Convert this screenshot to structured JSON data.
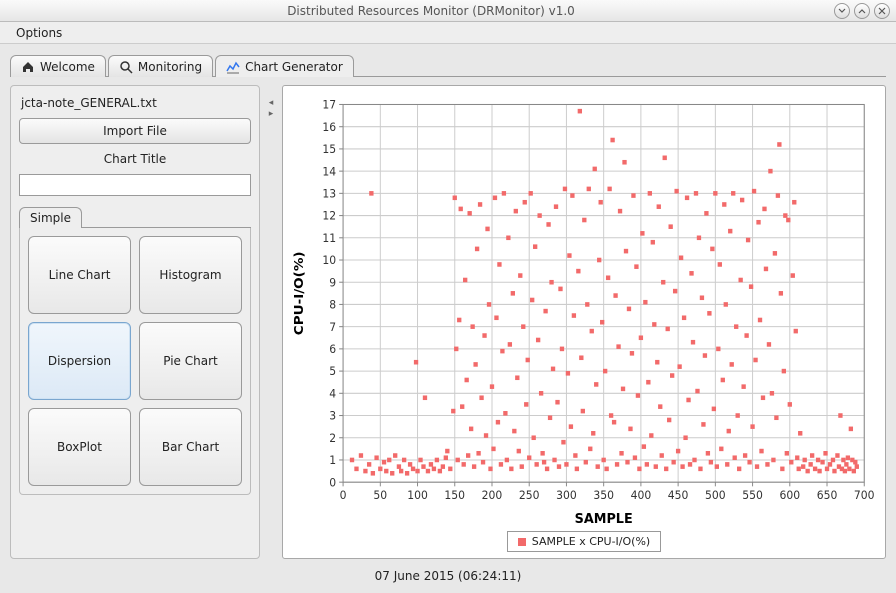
{
  "window": {
    "title": "Distributed Resources Monitor (DRMonitor) v1.0"
  },
  "menu": {
    "options": "Options"
  },
  "tabs": {
    "welcome": "Welcome",
    "monitoring": "Monitoring",
    "chart_gen": "Chart Generator"
  },
  "left": {
    "filename": "jcta-note_GENERAL.txt",
    "import_btn": "Import File",
    "chart_title_label": "Chart Title",
    "chart_title_value": "",
    "inner_tab": "Simple",
    "types": {
      "line": "Line Chart",
      "hist": "Histogram",
      "disp": "Dispersion",
      "pie": "Pie Chart",
      "box": "BoxPlot",
      "bar": "Bar Chart"
    }
  },
  "chart": {
    "xlabel": "SAMPLE",
    "ylabel": "CPU-I/O(%)",
    "legend": "SAMPLE x CPU-I/O(%)",
    "xrange": [
      0,
      700
    ],
    "yrange": [
      0,
      17
    ],
    "xticks": [
      0,
      50,
      100,
      150,
      200,
      250,
      300,
      350,
      400,
      450,
      500,
      550,
      600,
      650,
      700
    ],
    "yticks": [
      0,
      1,
      2,
      3,
      4,
      5,
      6,
      7,
      8,
      9,
      10,
      11,
      12,
      13,
      14,
      15,
      16,
      17
    ]
  },
  "status": {
    "text": "07 June 2015 (06:24:11)"
  },
  "chart_data": {
    "type": "scatter",
    "title": "",
    "xlabel": "SAMPLE",
    "ylabel": "CPU-I/O(%)",
    "xlim": [
      0,
      700
    ],
    "ylim": [
      0,
      17
    ],
    "series": [
      {
        "name": "SAMPLE x CPU-I/O(%)",
        "color": "#f26a6a",
        "points": [
          [
            12,
            1.0
          ],
          [
            18,
            0.6
          ],
          [
            24,
            1.2
          ],
          [
            30,
            0.5
          ],
          [
            35,
            0.8
          ],
          [
            38,
            13.0
          ],
          [
            40,
            0.4
          ],
          [
            45,
            1.1
          ],
          [
            50,
            0.6
          ],
          [
            55,
            0.9
          ],
          [
            58,
            0.5
          ],
          [
            62,
            1.0
          ],
          [
            66,
            0.4
          ],
          [
            70,
            1.2
          ],
          [
            75,
            0.7
          ],
          [
            78,
            0.5
          ],
          [
            82,
            1.0
          ],
          [
            86,
            0.4
          ],
          [
            90,
            0.8
          ],
          [
            94,
            0.6
          ],
          [
            98,
            5.4
          ],
          [
            100,
            0.5
          ],
          [
            104,
            1.0
          ],
          [
            108,
            0.7
          ],
          [
            110,
            3.8
          ],
          [
            114,
            0.5
          ],
          [
            118,
            0.8
          ],
          [
            122,
            0.6
          ],
          [
            126,
            1.0
          ],
          [
            130,
            0.5
          ],
          [
            134,
            0.7
          ],
          [
            138,
            1.1
          ],
          [
            140,
            1.4
          ],
          [
            144,
            0.6
          ],
          [
            148,
            3.2
          ],
          [
            150,
            12.8
          ],
          [
            152,
            6.0
          ],
          [
            154,
            1.0
          ],
          [
            156,
            7.3
          ],
          [
            158,
            12.3
          ],
          [
            160,
            3.4
          ],
          [
            162,
            0.8
          ],
          [
            164,
            9.1
          ],
          [
            166,
            4.6
          ],
          [
            168,
            1.2
          ],
          [
            170,
            12.1
          ],
          [
            172,
            2.4
          ],
          [
            174,
            7.0
          ],
          [
            176,
            0.7
          ],
          [
            178,
            5.3
          ],
          [
            180,
            10.5
          ],
          [
            182,
            1.3
          ],
          [
            184,
            12.5
          ],
          [
            186,
            3.8
          ],
          [
            188,
            0.9
          ],
          [
            190,
            6.6
          ],
          [
            192,
            2.1
          ],
          [
            194,
            11.4
          ],
          [
            196,
            8.0
          ],
          [
            198,
            0.6
          ],
          [
            200,
            4.3
          ],
          [
            202,
            1.5
          ],
          [
            204,
            12.8
          ],
          [
            206,
            7.4
          ],
          [
            208,
            2.7
          ],
          [
            210,
            9.8
          ],
          [
            212,
            0.8
          ],
          [
            214,
            5.9
          ],
          [
            216,
            13.0
          ],
          [
            218,
            3.1
          ],
          [
            220,
            1.0
          ],
          [
            222,
            11.0
          ],
          [
            224,
            6.2
          ],
          [
            226,
            0.6
          ],
          [
            228,
            8.5
          ],
          [
            230,
            2.3
          ],
          [
            232,
            12.2
          ],
          [
            234,
            4.7
          ],
          [
            236,
            1.4
          ],
          [
            238,
            9.3
          ],
          [
            240,
            0.7
          ],
          [
            242,
            7.0
          ],
          [
            244,
            12.6
          ],
          [
            246,
            3.5
          ],
          [
            248,
            5.5
          ],
          [
            250,
            1.1
          ],
          [
            252,
            13.0
          ],
          [
            254,
            8.2
          ],
          [
            256,
            2.0
          ],
          [
            258,
            10.6
          ],
          [
            260,
            0.8
          ],
          [
            262,
            6.4
          ],
          [
            264,
            12.0
          ],
          [
            266,
            4.0
          ],
          [
            268,
            1.3
          ],
          [
            270,
            0.9
          ],
          [
            272,
            7.7
          ],
          [
            274,
            0.6
          ],
          [
            276,
            11.6
          ],
          [
            278,
            2.9
          ],
          [
            280,
            9.0
          ],
          [
            282,
            5.1
          ],
          [
            284,
            1.0
          ],
          [
            286,
            12.4
          ],
          [
            288,
            3.6
          ],
          [
            290,
            0.7
          ],
          [
            292,
            8.7
          ],
          [
            294,
            6.0
          ],
          [
            296,
            1.8
          ],
          [
            298,
            13.2
          ],
          [
            300,
            0.8
          ],
          [
            302,
            4.9
          ],
          [
            304,
            10.2
          ],
          [
            306,
            2.5
          ],
          [
            308,
            12.9
          ],
          [
            310,
            7.5
          ],
          [
            312,
            1.2
          ],
          [
            314,
            0.6
          ],
          [
            316,
            9.5
          ],
          [
            318,
            16.7
          ],
          [
            320,
            5.6
          ],
          [
            322,
            3.2
          ],
          [
            324,
            11.8
          ],
          [
            326,
            0.9
          ],
          [
            328,
            8.0
          ],
          [
            330,
            13.2
          ],
          [
            332,
            1.5
          ],
          [
            334,
            6.8
          ],
          [
            336,
            2.2
          ],
          [
            338,
            14.1
          ],
          [
            340,
            4.4
          ],
          [
            342,
            0.7
          ],
          [
            344,
            10.0
          ],
          [
            346,
            12.6
          ],
          [
            348,
            7.2
          ],
          [
            350,
            1.0
          ],
          [
            352,
            5.0
          ],
          [
            354,
            0.6
          ],
          [
            356,
            9.2
          ],
          [
            358,
            13.2
          ],
          [
            360,
            3.0
          ],
          [
            362,
            15.4
          ],
          [
            364,
            2.7
          ],
          [
            366,
            8.4
          ],
          [
            368,
            0.8
          ],
          [
            370,
            6.1
          ],
          [
            372,
            12.2
          ],
          [
            374,
            1.3
          ],
          [
            376,
            4.2
          ],
          [
            378,
            14.4
          ],
          [
            380,
            10.4
          ],
          [
            382,
            0.9
          ],
          [
            384,
            7.8
          ],
          [
            386,
            2.4
          ],
          [
            388,
            5.8
          ],
          [
            390,
            12.9
          ],
          [
            392,
            1.1
          ],
          [
            394,
            9.7
          ],
          [
            396,
            3.9
          ],
          [
            398,
            0.6
          ],
          [
            400,
            6.5
          ],
          [
            402,
            11.2
          ],
          [
            404,
            1.6
          ],
          [
            406,
            8.1
          ],
          [
            408,
            0.8
          ],
          [
            410,
            4.5
          ],
          [
            412,
            13.0
          ],
          [
            414,
            2.1
          ],
          [
            416,
            10.8
          ],
          [
            418,
            7.1
          ],
          [
            420,
            0.7
          ],
          [
            422,
            5.4
          ],
          [
            424,
            12.4
          ],
          [
            426,
            3.4
          ],
          [
            428,
            1.2
          ],
          [
            430,
            9.0
          ],
          [
            432,
            14.6
          ],
          [
            434,
            0.6
          ],
          [
            436,
            6.9
          ],
          [
            438,
            2.8
          ],
          [
            440,
            11.5
          ],
          [
            442,
            4.8
          ],
          [
            444,
            0.9
          ],
          [
            446,
            8.6
          ],
          [
            448,
            13.1
          ],
          [
            450,
            1.4
          ],
          [
            452,
            5.2
          ],
          [
            454,
            10.1
          ],
          [
            456,
            0.7
          ],
          [
            458,
            7.4
          ],
          [
            460,
            2.0
          ],
          [
            462,
            12.8
          ],
          [
            464,
            3.7
          ],
          [
            466,
            0.8
          ],
          [
            468,
            9.4
          ],
          [
            470,
            6.3
          ],
          [
            472,
            1.0
          ],
          [
            474,
            13.0
          ],
          [
            476,
            4.1
          ],
          [
            478,
            11.0
          ],
          [
            480,
            0.6
          ],
          [
            482,
            8.3
          ],
          [
            484,
            2.6
          ],
          [
            486,
            5.7
          ],
          [
            488,
            12.1
          ],
          [
            490,
            1.3
          ],
          [
            492,
            7.6
          ],
          [
            494,
            0.9
          ],
          [
            496,
            10.5
          ],
          [
            498,
            3.3
          ],
          [
            500,
            13.0
          ],
          [
            502,
            0.7
          ],
          [
            504,
            6.0
          ],
          [
            506,
            9.8
          ],
          [
            508,
            1.5
          ],
          [
            510,
            4.6
          ],
          [
            512,
            12.5
          ],
          [
            514,
            8.0
          ],
          [
            516,
            0.8
          ],
          [
            518,
            2.3
          ],
          [
            520,
            11.3
          ],
          [
            522,
            5.3
          ],
          [
            524,
            13.0
          ],
          [
            526,
            1.1
          ],
          [
            528,
            7.0
          ],
          [
            530,
            3.0
          ],
          [
            532,
            0.6
          ],
          [
            534,
            9.1
          ],
          [
            536,
            12.7
          ],
          [
            538,
            4.3
          ],
          [
            540,
            1.2
          ],
          [
            542,
            6.6
          ],
          [
            544,
            10.9
          ],
          [
            546,
            0.9
          ],
          [
            548,
            8.8
          ],
          [
            550,
            2.5
          ],
          [
            552,
            13.1
          ],
          [
            554,
            5.5
          ],
          [
            556,
            0.7
          ],
          [
            558,
            11.7
          ],
          [
            560,
            7.3
          ],
          [
            562,
            1.4
          ],
          [
            564,
            3.8
          ],
          [
            566,
            12.3
          ],
          [
            568,
            9.6
          ],
          [
            570,
            0.8
          ],
          [
            572,
            6.2
          ],
          [
            574,
            14.0
          ],
          [
            576,
            4.0
          ],
          [
            578,
            1.0
          ],
          [
            580,
            10.3
          ],
          [
            582,
            2.9
          ],
          [
            584,
            12.9
          ],
          [
            586,
            15.2
          ],
          [
            588,
            8.5
          ],
          [
            590,
            0.6
          ],
          [
            592,
            5.0
          ],
          [
            594,
            12.0
          ],
          [
            596,
            1.3
          ],
          [
            598,
            11.8
          ],
          [
            600,
            3.5
          ],
          [
            602,
            0.9
          ],
          [
            604,
            9.3
          ],
          [
            606,
            12.6
          ],
          [
            608,
            6.8
          ],
          [
            610,
            1.1
          ],
          [
            612,
            0.6
          ],
          [
            614,
            2.2
          ],
          [
            618,
            0.7
          ],
          [
            620,
            1.0
          ],
          [
            624,
            0.5
          ],
          [
            628,
            0.8
          ],
          [
            630,
            1.2
          ],
          [
            634,
            0.6
          ],
          [
            638,
            1.0
          ],
          [
            640,
            0.5
          ],
          [
            644,
            0.9
          ],
          [
            648,
            1.3
          ],
          [
            650,
            0.6
          ],
          [
            654,
            0.8
          ],
          [
            658,
            1.0
          ],
          [
            660,
            0.5
          ],
          [
            664,
            1.2
          ],
          [
            666,
            0.7
          ],
          [
            668,
            3.0
          ],
          [
            670,
            0.6
          ],
          [
            672,
            1.0
          ],
          [
            674,
            0.5
          ],
          [
            676,
            0.8
          ],
          [
            678,
            1.1
          ],
          [
            680,
            0.6
          ],
          [
            682,
            2.4
          ],
          [
            684,
            1.0
          ],
          [
            686,
            0.5
          ],
          [
            688,
            0.9
          ],
          [
            690,
            0.7
          ]
        ]
      }
    ]
  }
}
